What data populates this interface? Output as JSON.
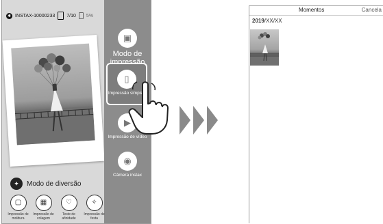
{
  "left_screen": {
    "device_name": "INSTAX-10000233",
    "prints_left": "7/10",
    "battery_pct": "5%",
    "icons": {
      "bluetooth": "bluetooth-icon",
      "settings": "gear-icon"
    },
    "side_menu": {
      "print_mode": "Modo de impressão",
      "simple_print": "Impressão simples",
      "print_from_video": "Impressão de vídeo",
      "instax_camera": "Câmera instax"
    },
    "fun_mode": {
      "title": "Modo de diversão",
      "items": [
        "Impressão de moldura",
        "Impressão de colagem",
        "Teste de afinidade",
        "Impressão de festa"
      ]
    }
  },
  "right_screen": {
    "title": "Momentos",
    "cancel_label": "Cancela",
    "date_year": "2019",
    "date_rest": "/XX/XX"
  }
}
